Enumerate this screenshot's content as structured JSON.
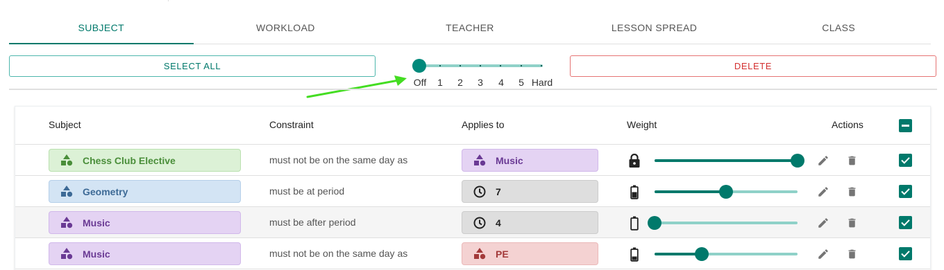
{
  "tabs": [
    {
      "label": "SUBJECT",
      "active": true
    },
    {
      "label": "WORKLOAD",
      "active": false
    },
    {
      "label": "TEACHER",
      "active": false
    },
    {
      "label": "LESSON SPREAD",
      "active": false
    },
    {
      "label": "CLASS",
      "active": false
    }
  ],
  "toolbar": {
    "select_all_label": "SELECT ALL",
    "delete_label": "DELETE",
    "level_slider": {
      "marks": [
        "Off",
        "1",
        "2",
        "3",
        "4",
        "5",
        "Hard"
      ],
      "selected": "Off"
    }
  },
  "table": {
    "headers": {
      "subject": "Subject",
      "constraint": "Constraint",
      "applies_to": "Applies to",
      "weight": "Weight",
      "actions": "Actions"
    },
    "header_checkbox": "indeterminate",
    "rows": [
      {
        "subject": "Chess Club Elective",
        "subject_colors": {
          "bg": "#dcf1d6",
          "border": "#b9e0ae",
          "fg": "#4a8e3a"
        },
        "constraint": "must not be on the same day as",
        "applies_to": "Music",
        "applies_icon": "shapes-icon",
        "applies_colors": {
          "bg": "#e4d3f3",
          "border": "#d1b8ea",
          "fg": "#6a3a94"
        },
        "weight_icon": "lock-icon",
        "weight": 1.0,
        "checked": true,
        "shaded": false
      },
      {
        "subject": "Geometry",
        "subject_colors": {
          "bg": "#d3e4f4",
          "border": "#b5cfe9",
          "fg": "#3d6a96"
        },
        "constraint": "must be at period",
        "applies_to": "7",
        "applies_icon": "clock-icon",
        "applies_colors": {
          "bg": "#dedede",
          "border": "#cccccc",
          "fg": "#222222"
        },
        "weight_icon": "battery-half-icon",
        "weight": 0.5,
        "checked": true,
        "shaded": false
      },
      {
        "subject": "Music",
        "subject_colors": {
          "bg": "#e4d3f3",
          "border": "#d1b8ea",
          "fg": "#6a3a94"
        },
        "constraint": "must be after period",
        "applies_to": "4",
        "applies_icon": "clock-icon",
        "applies_colors": {
          "bg": "#dedede",
          "border": "#cccccc",
          "fg": "#222222"
        },
        "weight_icon": "battery-empty-icon",
        "weight": 0.0,
        "checked": true,
        "shaded": true
      },
      {
        "subject": "Music",
        "subject_colors": {
          "bg": "#e4d3f3",
          "border": "#d1b8ea",
          "fg": "#6a3a94"
        },
        "constraint": "must not be on the same day as",
        "applies_to": "PE",
        "applies_icon": "shapes-icon",
        "applies_colors": {
          "bg": "#f4d2d2",
          "border": "#ebb8b8",
          "fg": "#a33a3a"
        },
        "weight_icon": "battery-low-icon",
        "weight": 0.33,
        "checked": true,
        "shaded": false
      }
    ]
  },
  "colors": {
    "accent": "#00796b",
    "danger": "#d32f2f",
    "annotation_arrow": "#44dd22"
  }
}
